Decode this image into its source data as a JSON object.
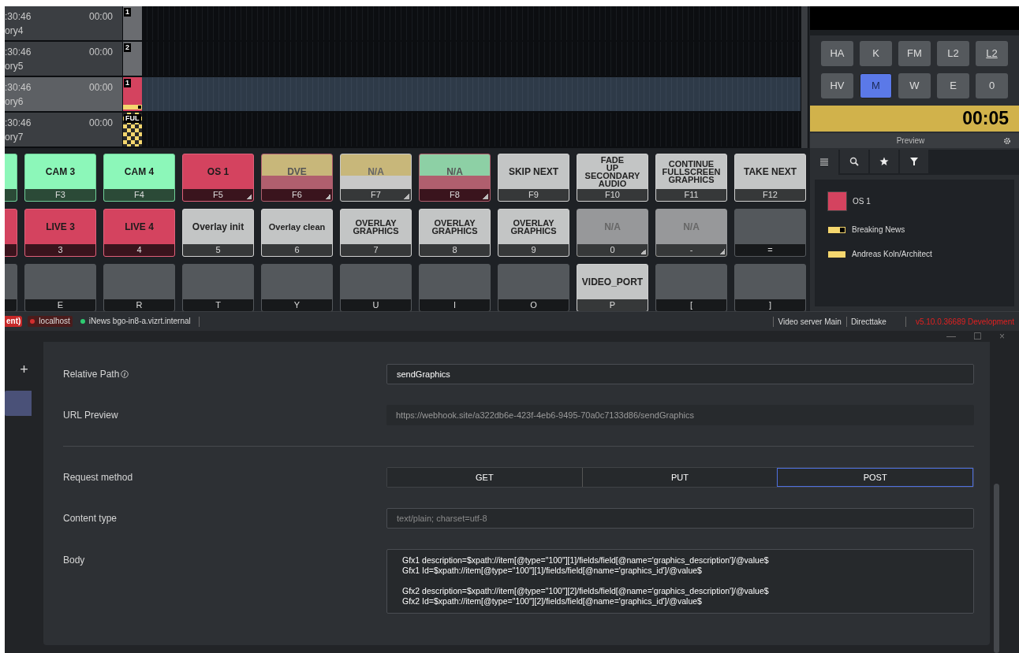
{
  "timeline": {
    "rows": [
      {
        "time": ":30:46",
        "duration": "00:00",
        "name": "ory4",
        "selected": false,
        "clip": {
          "kind": "grey",
          "label": "1"
        }
      },
      {
        "time": ":30:46",
        "duration": "00:00",
        "name": "ory5",
        "selected": false,
        "clip": {
          "kind": "grey",
          "label": "2"
        }
      },
      {
        "time": ":30:46",
        "duration": "00:00",
        "name": "ory6",
        "selected": true,
        "clip": {
          "kind": "red",
          "label": "1"
        }
      },
      {
        "time": ":30:46",
        "duration": "00:00",
        "name": "ory7",
        "selected": false,
        "clip": {
          "kind": "checker",
          "label": "FUL"
        }
      }
    ]
  },
  "shortcut_rows": [
    [
      {
        "kind": "green",
        "corner": false
      },
      {
        "kind": "green",
        "label": "CAM 3",
        "key": "F3",
        "corner": false
      },
      {
        "kind": "green",
        "label": "CAM 4",
        "key": "F4",
        "corner": false
      },
      {
        "kind": "red",
        "label": "OS 1",
        "key": "F5",
        "corner": true
      },
      {
        "kind": "dve",
        "label": "DVE",
        "key": "F6",
        "corner": true
      },
      {
        "kind": "na_yellow",
        "label": "N/A",
        "key": "F7",
        "corner": true
      },
      {
        "kind": "na_green",
        "label": "N/A",
        "key": "F8",
        "corner": true
      },
      {
        "kind": "light",
        "label": "SKIP NEXT",
        "key": "F9",
        "corner": false
      },
      {
        "kind": "light",
        "label": "FADE UP SECONDARY AUDIO",
        "key": "F10",
        "corner": false
      },
      {
        "kind": "light",
        "label": "CONTINUE FULLSCREEN GRAPHICS",
        "key": "F11",
        "corner": false
      },
      {
        "kind": "light",
        "label": "TAKE NEXT",
        "key": "F12",
        "corner": false
      }
    ],
    [
      {
        "kind": "red",
        "corner": false
      },
      {
        "kind": "red",
        "label": "LIVE 3",
        "key": "3",
        "corner": false
      },
      {
        "kind": "red",
        "label": "LIVE 4",
        "key": "4",
        "corner": false
      },
      {
        "kind": "light",
        "label": "Overlay init",
        "key": "5",
        "corner": false
      },
      {
        "kind": "light",
        "label": "Overlay clean",
        "key": "6",
        "corner": false
      },
      {
        "kind": "light",
        "label": "OVERLAY GRAPHICS",
        "key": "7",
        "corner": false
      },
      {
        "kind": "light",
        "label": "OVERLAY GRAPHICS",
        "key": "8",
        "corner": false
      },
      {
        "kind": "light",
        "label": "OVERLAY GRAPHICS",
        "key": "9",
        "corner": false
      },
      {
        "kind": "dim_na",
        "label": "N/A",
        "key": "0",
        "corner": true
      },
      {
        "kind": "dim_na",
        "label": "N/A",
        "key": "-",
        "corner": true
      },
      {
        "kind": "empty",
        "key": "=",
        "corner": false
      }
    ],
    [
      {
        "kind": "empty",
        "corner": false
      },
      {
        "kind": "empty",
        "key": "E",
        "corner": false
      },
      {
        "kind": "empty",
        "key": "R",
        "corner": false
      },
      {
        "kind": "empty",
        "key": "T",
        "corner": false
      },
      {
        "kind": "empty",
        "key": "Y",
        "corner": false
      },
      {
        "kind": "empty",
        "key": "U",
        "corner": false
      },
      {
        "kind": "empty",
        "key": "I",
        "corner": false
      },
      {
        "kind": "empty",
        "key": "O",
        "corner": false
      },
      {
        "kind": "light",
        "label": "VIDEO_PORT",
        "key": "P",
        "corner": false
      },
      {
        "kind": "empty",
        "key": "[",
        "corner": false
      },
      {
        "kind": "empty",
        "key": "]",
        "corner": false
      }
    ]
  ],
  "mode_buttons": [
    {
      "label": "HA",
      "selected": false,
      "underlined": false
    },
    {
      "label": "K",
      "selected": false,
      "underlined": false
    },
    {
      "label": "FM",
      "selected": false,
      "underlined": false
    },
    {
      "label": "L2",
      "selected": false,
      "underlined": false
    },
    {
      "label": "L2",
      "selected": false,
      "underlined": true
    },
    {
      "label": "HV",
      "selected": false,
      "underlined": false
    },
    {
      "label": "M",
      "selected": true,
      "underlined": false
    },
    {
      "label": "W",
      "selected": false,
      "underlined": false
    },
    {
      "label": "E",
      "selected": false,
      "underlined": false
    },
    {
      "label": "0",
      "selected": false,
      "underlined": false
    }
  ],
  "timer": "00:05",
  "preview": {
    "title": "Preview",
    "tabs": [
      {
        "kind": "list",
        "selected": true
      },
      {
        "kind": "search",
        "selected": false
      },
      {
        "kind": "star",
        "selected": false
      },
      {
        "kind": "filter",
        "selected": false
      }
    ],
    "items": [
      {
        "kind": "square",
        "color": "#d4435f",
        "label": "OS 1"
      },
      {
        "kind": "toggle",
        "color": "#f5d76e",
        "label": "Breaking News"
      },
      {
        "kind": "bar",
        "color": "#f5d76e",
        "label": "Andreas Koln/Architect"
      }
    ]
  },
  "status_bar": {
    "left": [
      {
        "kind": "badge",
        "text": "ent)"
      },
      {
        "kind": "tag",
        "text": "localhost",
        "color": "#d32f2f"
      },
      {
        "kind": "dot",
        "text": "iNews bgo-in8-a.vizrt.internal",
        "color": "#2ecc71"
      }
    ],
    "right": [
      {
        "kind": "plain",
        "text": "Video server Main"
      },
      {
        "kind": "plain",
        "text": "Directtake"
      },
      {
        "kind": "error",
        "text": "v5.10.0.36689 Development"
      }
    ]
  },
  "window_controls": [
    "—",
    "☐",
    "×"
  ],
  "sidebar": {
    "add": "+"
  },
  "form": {
    "relative_path": {
      "label": "Relative Path",
      "value": "sendGraphics"
    },
    "url_preview": {
      "label": "URL Preview",
      "value": "https://webhook.site/a322db6e-423f-4eb6-9495-70a0c7133d86/sendGraphics"
    },
    "request_method": {
      "label": "Request method",
      "options": [
        {
          "label": "GET",
          "selected": false
        },
        {
          "label": "PUT",
          "selected": false
        },
        {
          "label": "POST",
          "selected": true
        }
      ]
    },
    "content_type": {
      "label": "Content type",
      "placeholder": "text/plain; charset=utf-8"
    },
    "body": {
      "label": "Body",
      "value": "Gfx1 description=$xpath://item[@type=\"100\"][1]/fields/field[@name='graphics_description']/@value$\nGfx1 Id=$xpath://item[@type=\"100\"][1]/fields/field[@name='graphics_id']/@value$\n\nGfx2 description=$xpath://item[@type=\"100\"][2]/fields/field[@name='graphics_description']/@value$\nGfx2 Id=$xpath://item[@type=\"100\"][2]/fields/field[@name='graphics_id']/@value$"
    }
  }
}
